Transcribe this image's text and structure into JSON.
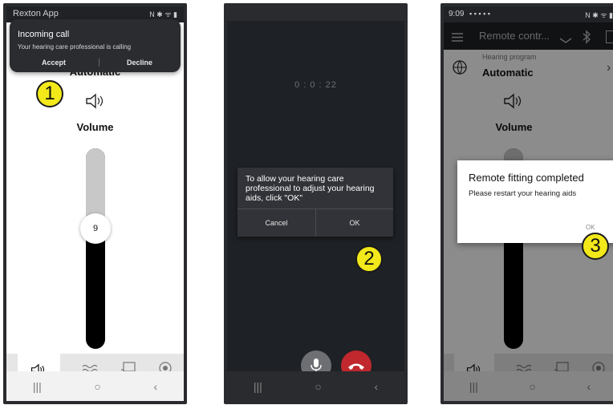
{
  "phone1": {
    "status": {
      "app": "Rexton App",
      "icons": "N ✱ ᯤ ▮"
    },
    "notification": {
      "title": "Incoming call",
      "body": "Your hearing care professional is calling",
      "accept": "Accept",
      "decline": "Decline"
    },
    "program_name": "Automatic",
    "volume_label": "Volume",
    "volume_value": "9",
    "volume_fraction": 0.55,
    "step": "1"
  },
  "phone2": {
    "timer": "0 : 0 : 22",
    "dialog": {
      "message": "To allow your hearing care professional to adjust your hearing aids, click \"OK\"",
      "cancel": "Cancel",
      "ok": "OK"
    },
    "step": "2"
  },
  "phone3": {
    "status": {
      "time": "9:09",
      "icons": "N ✱ ᯤ ▮"
    },
    "toolbar_title": "Remote contr...",
    "program_label": "Hearing program",
    "program_name": "Automatic",
    "volume_label": "Volume",
    "dialog": {
      "title": "Remote fitting completed",
      "body": "Please restart your hearing aids",
      "ok": "OK"
    },
    "step": "3"
  },
  "icons": [
    "speaker-icon",
    "equalizer-icon",
    "cast-icon",
    "record-icon",
    "globe-icon",
    "bluetooth-icon",
    "menu-icon",
    "mic-icon",
    "hangup-icon"
  ],
  "colors": {
    "badge": "#f2e81a",
    "hangup": "#c0282e",
    "dark_bg": "#1e2125",
    "toolbar": "#202226"
  }
}
